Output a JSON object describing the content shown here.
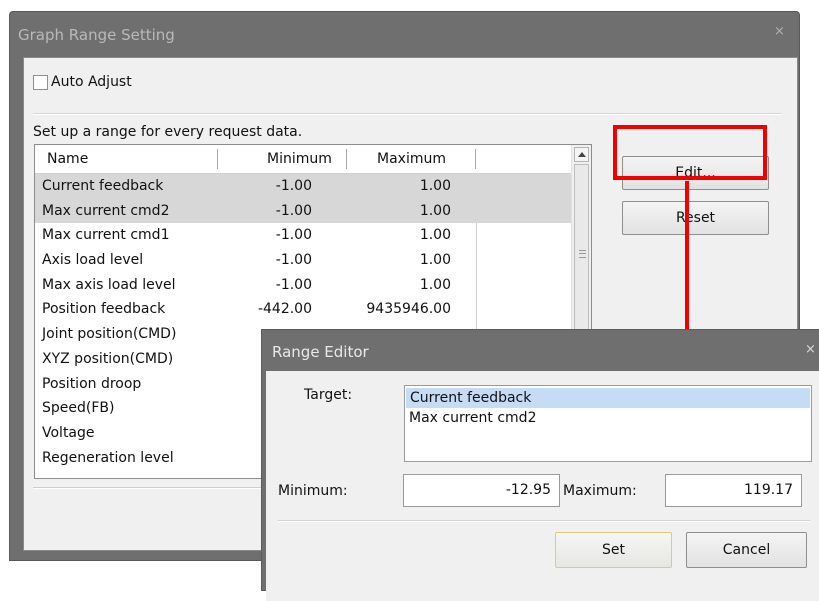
{
  "main_dialog": {
    "title": "Graph Range Setting",
    "close_glyph": "×",
    "auto_adjust": {
      "label": "Auto Adjust",
      "checked": false
    },
    "instruction": "Set up a range for every request data.",
    "table": {
      "columns": [
        "Name",
        "Minimum",
        "Maximum"
      ],
      "rows": [
        {
          "name": "Current feedback",
          "min": "-1.00",
          "max": "1.00",
          "selected": true
        },
        {
          "name": "Max current cmd2",
          "min": "-1.00",
          "max": "1.00",
          "selected": true
        },
        {
          "name": "Max current cmd1",
          "min": "-1.00",
          "max": "1.00",
          "selected": false
        },
        {
          "name": "Axis load level",
          "min": "-1.00",
          "max": "1.00",
          "selected": false
        },
        {
          "name": "Max axis load level",
          "min": "-1.00",
          "max": "1.00",
          "selected": false
        },
        {
          "name": "Position feedback",
          "min": "-442.00",
          "max": "9435946.00",
          "selected": false
        },
        {
          "name": "Joint position(CMD)",
          "min": "",
          "max": "",
          "selected": false
        },
        {
          "name": "XYZ position(CMD)",
          "min": "",
          "max": "",
          "selected": false
        },
        {
          "name": "Position droop",
          "min": "",
          "max": "",
          "selected": false
        },
        {
          "name": "Speed(FB)",
          "min": "",
          "max": "",
          "selected": false
        },
        {
          "name": "Voltage",
          "min": "",
          "max": "",
          "selected": false
        },
        {
          "name": "Regeneration level",
          "min": "",
          "max": "",
          "selected": false
        }
      ]
    },
    "buttons": {
      "edit": "Edit...",
      "reset": "Reset"
    }
  },
  "range_editor": {
    "title": "Range Editor",
    "close_glyph": "×",
    "target_label": "Target:",
    "targets": [
      {
        "label": "Current feedback",
        "selected": true
      },
      {
        "label": "Max current cmd2",
        "selected": false
      }
    ],
    "minimum_label": "Minimum:",
    "minimum_value": "-12.95",
    "maximum_label": "Maximum:",
    "maximum_value": "119.17",
    "buttons": {
      "set": "Set",
      "cancel": "Cancel"
    }
  },
  "annotation": {
    "color": "#f20000",
    "highlight_target": "Edit..."
  }
}
